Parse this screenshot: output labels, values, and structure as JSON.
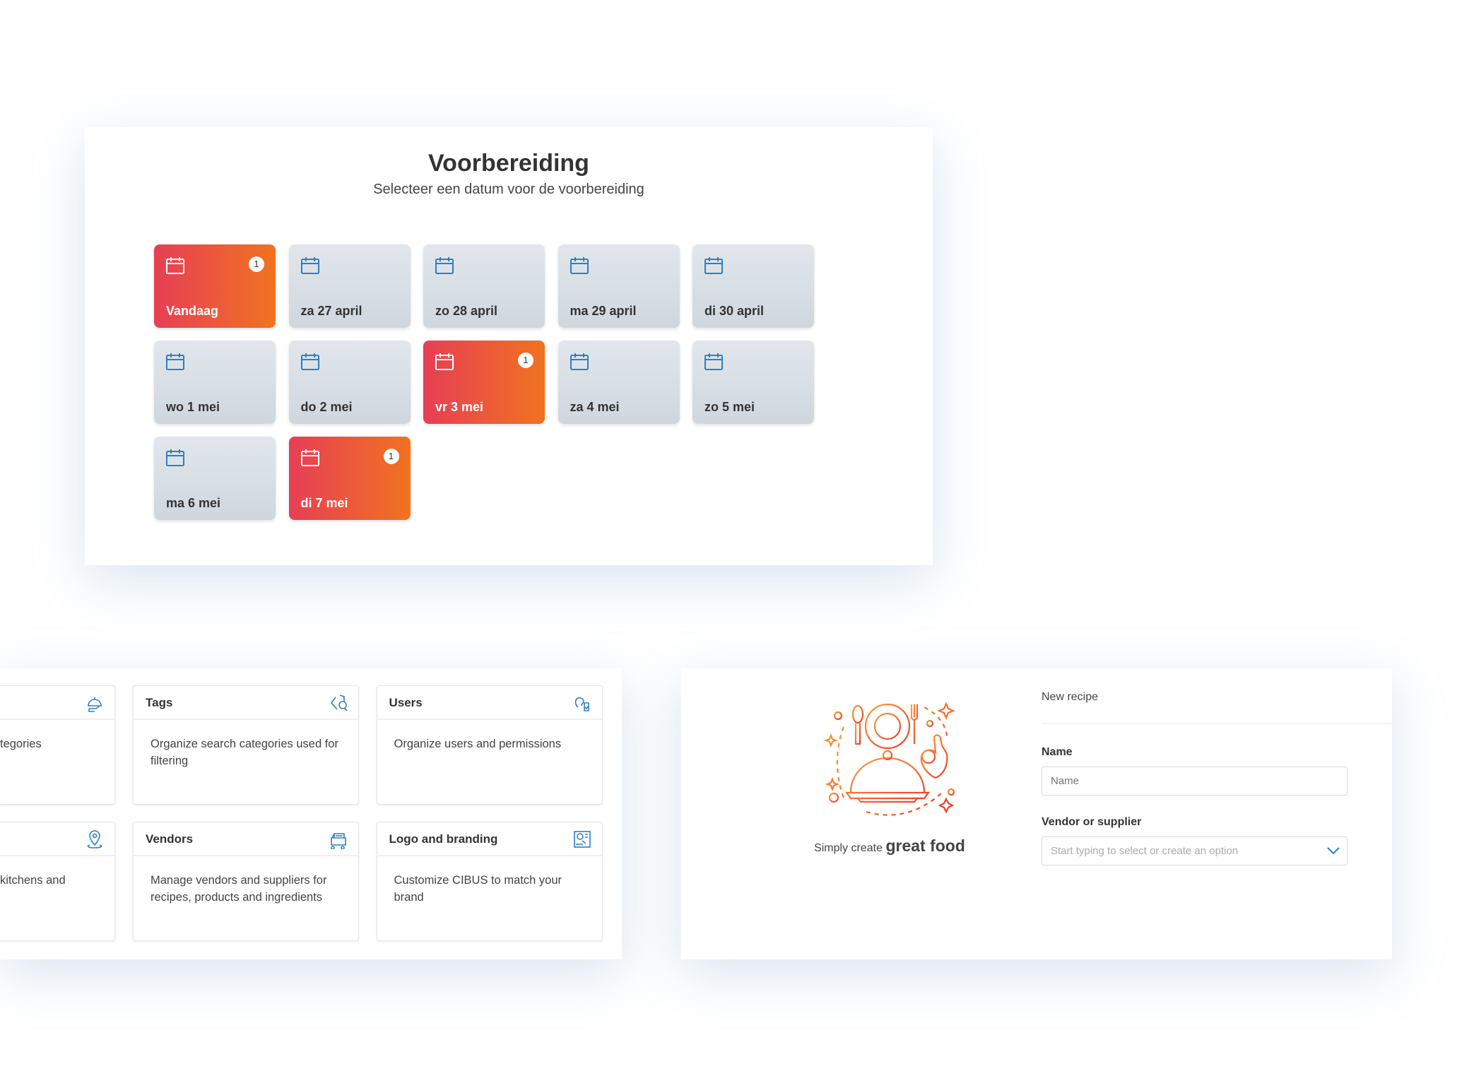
{
  "preparation": {
    "title": "Voorbereiding",
    "subtitle": "Selecteer een datum voor de voorbereiding",
    "dates": [
      {
        "label": "Vandaag",
        "active": true,
        "badge": "1"
      },
      {
        "label": "za 27 april",
        "active": false
      },
      {
        "label": "zo 28 april",
        "active": false
      },
      {
        "label": "ma 29 april",
        "active": false
      },
      {
        "label": "di 30 april",
        "active": false
      },
      {
        "label": "wo 1 mei",
        "active": false
      },
      {
        "label": "do 2 mei",
        "active": false
      },
      {
        "label": "vr 3 mei",
        "active": true,
        "badge": "1"
      },
      {
        "label": "za 4 mei",
        "active": false
      },
      {
        "label": "zo 5 mei",
        "active": false
      },
      {
        "label": "ma 6 mei",
        "active": false
      },
      {
        "label": "di 7 mei",
        "active": true,
        "badge": "1"
      }
    ]
  },
  "settings": {
    "cards": [
      {
        "title": "",
        "icon": "cloche-icon",
        "description": "tegories"
      },
      {
        "title": "Tags",
        "icon": "tag-search-icon",
        "description": "Organize search categories used for filtering"
      },
      {
        "title": "Users",
        "icon": "user-check-icon",
        "description": "Organize users and permissions"
      },
      {
        "title": "",
        "icon": "location-pin-icon",
        "description": "kitchens and"
      },
      {
        "title": "Vendors",
        "icon": "food-truck-icon",
        "description": "Manage vendors and suppliers for recipes, products and ingredients"
      },
      {
        "title": "Logo and branding",
        "icon": "branding-icon",
        "description": "Customize CIBUS to match your brand"
      }
    ]
  },
  "recipe": {
    "tagline_prefix": "Simply create",
    "tagline_emphasis": "great food",
    "header": "New recipe",
    "name_label": "Name",
    "name_placeholder": "Name",
    "vendor_label": "Vendor or supplier",
    "vendor_placeholder": "Start typing to select or create an option"
  },
  "colors": {
    "accent_start": "#e73e55",
    "accent_end": "#f07320",
    "icon_blue": "#2f7fc1"
  }
}
